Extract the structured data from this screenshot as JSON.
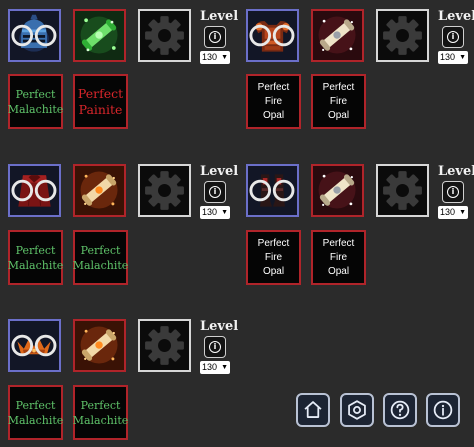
{
  "groups": [
    {
      "id": "g1",
      "level_label": "Level",
      "level_value": "130",
      "slots": {
        "armor": "knight-helmet-icon",
        "scroll": "green-scroll-icon",
        "gear": "gear-icon"
      },
      "gems": [
        {
          "name": "Perfect Malachite",
          "lines": [
            "Perfect",
            "Malachite"
          ],
          "type": "malachite"
        },
        {
          "name": "Perfect Painite",
          "lines": [
            "Perfect",
            "Painite"
          ],
          "type": "painite"
        }
      ]
    },
    {
      "id": "g2",
      "level_label": "Level",
      "level_value": "130",
      "slots": {
        "armor": "fire-chestplate-icon",
        "scroll": "white-scroll-icon",
        "gear": "gear-icon"
      },
      "gems": [
        {
          "name": "Perfect Fire Opal",
          "lines": [
            "Perfect Fire",
            "Opal"
          ],
          "type": "fireopal"
        },
        {
          "name": "Perfect Fire Opal",
          "lines": [
            "Perfect Fire",
            "Opal"
          ],
          "type": "fireopal"
        }
      ]
    },
    {
      "id": "g3",
      "level_label": "Level",
      "level_value": "130",
      "slots": {
        "armor": "red-cape-icon",
        "scroll": "orange-scroll-icon",
        "gear": "gear-icon"
      },
      "gems": [
        {
          "name": "Perfect Malachite",
          "lines": [
            "Perfect",
            "Malachite"
          ],
          "type": "malachite"
        },
        {
          "name": "Perfect Malachite",
          "lines": [
            "Perfect",
            "Malachite"
          ],
          "type": "malachite"
        }
      ]
    },
    {
      "id": "g4",
      "level_label": "Level",
      "level_value": "130",
      "slots": {
        "armor": "dark-boots-icon",
        "scroll": "white-scroll-icon",
        "gear": "gear-icon"
      },
      "gems": [
        {
          "name": "Perfect Fire Opal",
          "lines": [
            "Perfect Fire",
            "Opal"
          ],
          "type": "fireopal"
        },
        {
          "name": "Perfect Fire Opal",
          "lines": [
            "Perfect Fire",
            "Opal"
          ],
          "type": "fireopal"
        }
      ]
    },
    {
      "id": "g5",
      "level_label": "Level",
      "level_value": "130",
      "slots": {
        "armor": "flame-crown-icon",
        "scroll": "orange-scroll-icon",
        "gear": "gear-icon"
      },
      "gems": [
        {
          "name": "Perfect Malachite",
          "lines": [
            "Perfect",
            "Malachite"
          ],
          "type": "malachite"
        },
        {
          "name": "Perfect Malachite",
          "lines": [
            "Perfect",
            "Malachite"
          ],
          "type": "malachite"
        }
      ]
    }
  ],
  "nav": [
    {
      "name": "home-icon"
    },
    {
      "name": "hexagon-settings-icon"
    },
    {
      "name": "help-icon"
    },
    {
      "name": "info-icon"
    }
  ],
  "colors": {
    "background": "#2b2b2b",
    "rare_border": "#6b6fc9",
    "epic_border": "#b0242a",
    "empty_border": "#d6d6d6",
    "malachite_text": "#5fc36a",
    "painite_text": "#d8262b",
    "fireopal_text": "#ffffff"
  }
}
